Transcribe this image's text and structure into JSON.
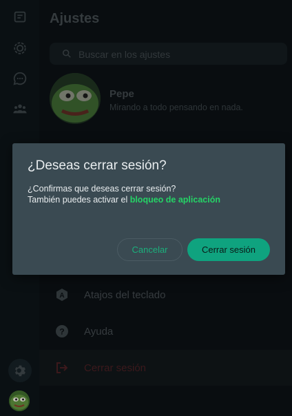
{
  "settings": {
    "title": "Ajustes",
    "search_placeholder": "Buscar en los ajustes",
    "profile": {
      "name": "Pepe",
      "status": "Mirando a todo pensando en nada."
    },
    "menu": {
      "shortcuts": "Atajos del teclado",
      "help": "Ayuda",
      "logout": "Cerrar sesión"
    }
  },
  "rail": {
    "icons": [
      "chats-icon",
      "status-icon",
      "channels-icon",
      "communities-icon",
      "settings-icon"
    ]
  },
  "dialog": {
    "title": "¿Deseas cerrar sesión?",
    "line1": "¿Confirmas que deseas cerrar sesión?",
    "line2_prefix": "También puedes activar el ",
    "line2_link": "bloqueo de aplicación",
    "cancel": "Cancelar",
    "confirm": "Cerrar sesión"
  },
  "colors": {
    "accent": "#25d366",
    "danger": "#ea0038",
    "dialog_bg": "#3a4a52"
  }
}
